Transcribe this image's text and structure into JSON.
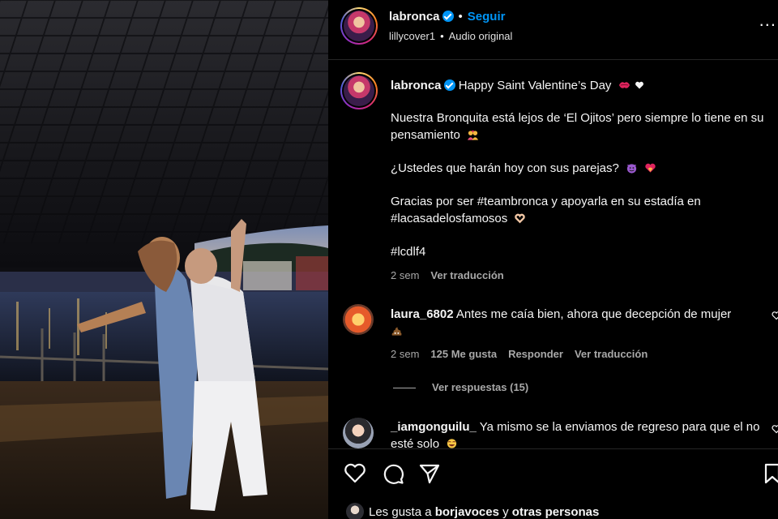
{
  "post_header": {
    "username": "labronca",
    "follow_label": "Seguir",
    "audio_author": "lillycover1",
    "audio_label": "Audio original",
    "more_label": "..."
  },
  "caption": {
    "username": "labronca",
    "first_line": "Happy Saint Valentine’s Day",
    "paragraph_1": "Nuestra Bronquita está lejos de ‘El Ojitos’ pero siempre lo tiene en su pensamiento",
    "paragraph_2": "¿Ustedes que harán hoy con sus parejas?",
    "paragraph_3": "Gracias por ser #teambronca y apoyarla en su estadía en #lacasadelosfamosos",
    "paragraph_4": "#lcdlf4",
    "time": "2 sem",
    "translate": "Ver traducción"
  },
  "comments": [
    {
      "username": "laura_6802",
      "text": "Antes me caía bien, ahora que decepción de mujer",
      "time": "2 sem",
      "likes": "125 Me gusta",
      "reply": "Responder",
      "translate": "Ver traducción",
      "view_replies": "Ver respuestas (15)"
    },
    {
      "username": "_iamgonguilu_",
      "text": "Ya mismo se la enviamos de regreso para que el no esté solo"
    }
  ],
  "footer": {
    "likes_prefix": "Les gusta a",
    "likes_user": "borjavoces",
    "likes_and": "y",
    "likes_others": "otras personas"
  },
  "icons": {
    "like": "heart-icon",
    "comment": "comment-icon",
    "share": "share-icon",
    "save": "bookmark-icon",
    "verified": "verified-badge-icon"
  },
  "colors": {
    "accent_blue": "#0095f6",
    "muted_text": "#a8a8a8",
    "divider": "#262626"
  }
}
